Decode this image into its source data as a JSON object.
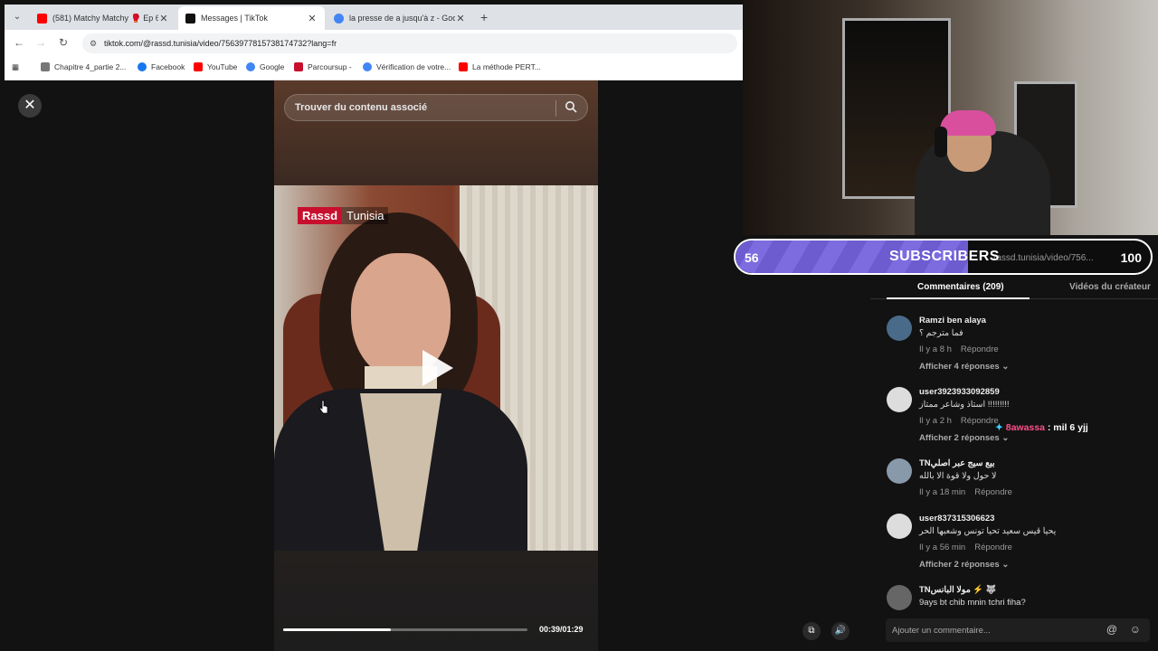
{
  "browser": {
    "tabs": [
      {
        "title": "(581) Matchy Matchy 🥊 Ep 63",
        "favicon_color": "#ff0000"
      },
      {
        "title": "Messages | TikTok",
        "favicon_color": "#111111"
      },
      {
        "title": "la presse de a jusqu'à z - Goog",
        "favicon_color": "#4285f4"
      }
    ],
    "new_tab": "+",
    "url": "tiktok.com/@rassd.tunisia/video/7563977815738174732?lang=fr",
    "bookmarks": [
      {
        "label": "Chapitre 4_partie 2...",
        "color": "#777777"
      },
      {
        "label": "Facebook",
        "color": "#1877f2"
      },
      {
        "label": "YouTube",
        "color": "#ff0000"
      },
      {
        "label": "Google",
        "color": "#4285f4"
      },
      {
        "label": "Parcoursup -",
        "color": "#c8102e"
      },
      {
        "label": "Vérification de votre...",
        "color": "#4285f4"
      },
      {
        "label": "La méthode PERT...",
        "color": "#ff0000"
      }
    ]
  },
  "video": {
    "search_placeholder": "Trouver du contenu associé",
    "logo_part1": "Rassd",
    "logo_part2": "Tunisia",
    "time": "00:39/01:29",
    "progress": 0.44
  },
  "subscribers": {
    "current": "56",
    "label": "SUBSCRIBERS",
    "goal": "100",
    "progress": 0.56,
    "ghost_url": "rassd.tunisia/video/756..."
  },
  "comments": {
    "tab_comments": "Commentaires (209)",
    "tab_creator": "Vidéos du créateur",
    "items": [
      {
        "user": "Ramzi ben alaya",
        "text": "فما مترجم ؟",
        "time": "Il y a 8 h",
        "reply": "Répondre",
        "more": "Afficher 4 réponses ⌄"
      },
      {
        "user": "user3923933092859",
        "text": "استاذ وشاعر ممتاز !!!!!!!!!",
        "time": "Il y a 2 h",
        "reply": "Répondre",
        "more": "Afficher 2 réponses ⌄"
      },
      {
        "user": "TNبيع سيج عبر اصلي",
        "text": "لا حول ولا قوة الا بالله",
        "time": "Il y a 18 min",
        "reply": "Répondre",
        "more": ""
      },
      {
        "user": "user837315306623",
        "text": "يحيا قيس سعيد تحيا تونس وشعبها الحر",
        "time": "Il y a 56 min",
        "reply": "Répondre",
        "more": "Afficher 2 réponses ⌄"
      },
      {
        "user": "TNمولا البانس ⚡ 🐺",
        "text": "9ays bt chib mnin tchri fiha?",
        "time": "",
        "reply": "",
        "more": ""
      }
    ],
    "input_placeholder": "Ajouter un commentaire...",
    "at_icon": "@",
    "emoji_icon": "☺"
  },
  "chat_overlay": {
    "icon": "✦",
    "name": "8awassa",
    "message": " : mil 6 yjj"
  }
}
